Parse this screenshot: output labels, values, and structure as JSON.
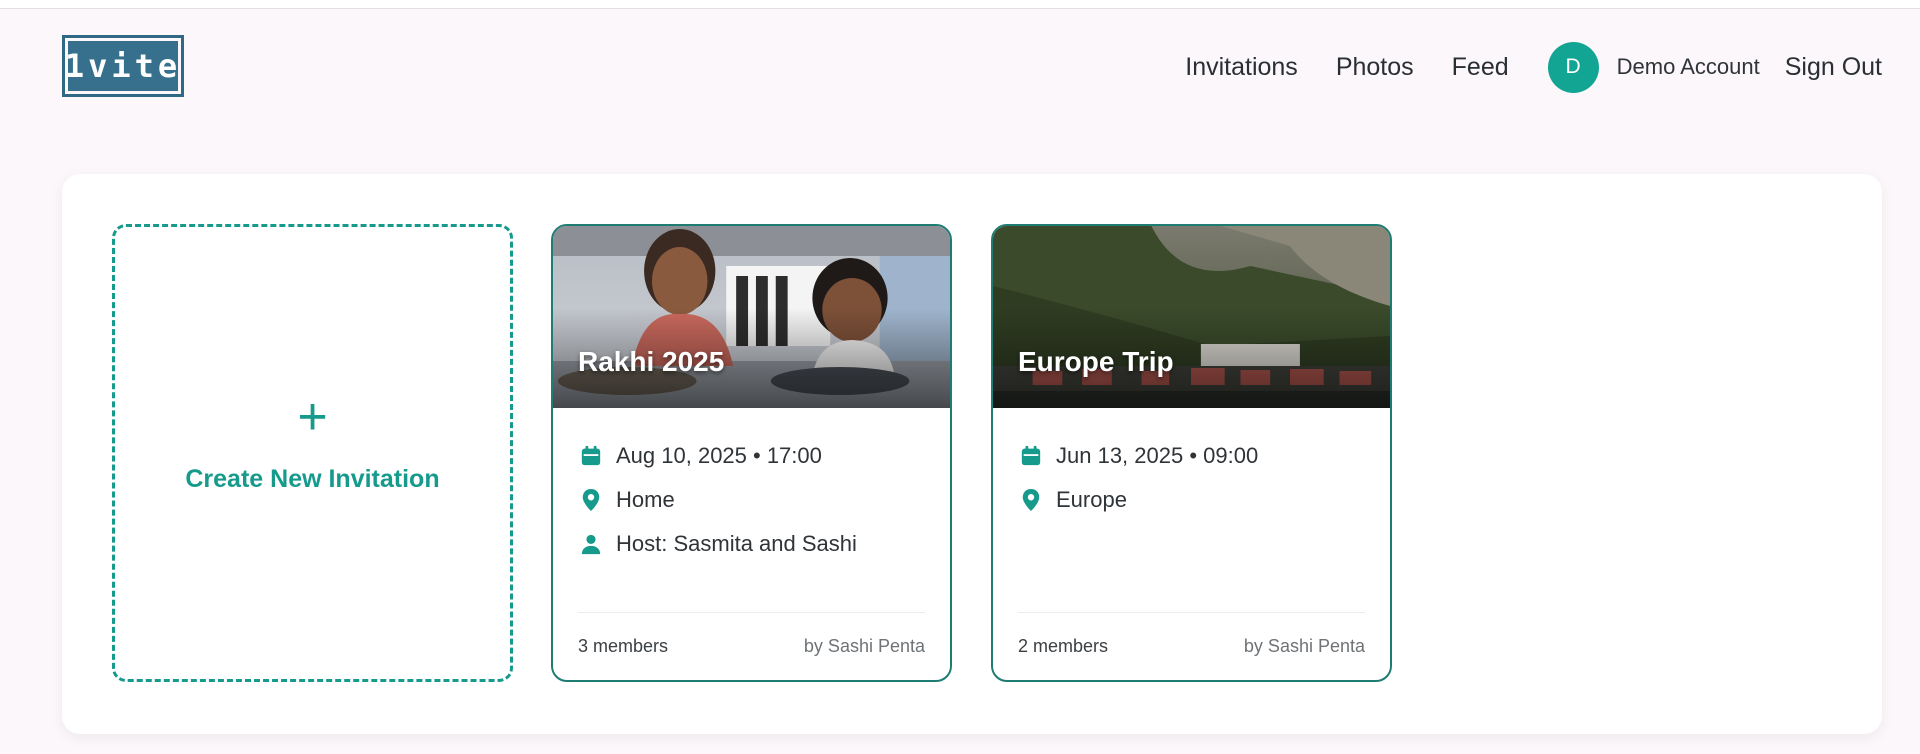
{
  "app": {
    "logo_text": "1vite"
  },
  "nav": {
    "items": [
      {
        "label": "Invitations"
      },
      {
        "label": "Photos"
      },
      {
        "label": "Feed"
      }
    ],
    "account": {
      "avatar_initial": "D",
      "name": "Demo Account"
    },
    "sign_out": "Sign Out"
  },
  "create_card": {
    "plus": "+",
    "label": "Create New Invitation"
  },
  "events": [
    {
      "title": "Rakhi 2025",
      "date": "Aug 10, 2025 • 17:00",
      "location": "Home",
      "host": "Host: Sasmita and Sashi",
      "members": "3 members",
      "by": "by Sashi Penta"
    },
    {
      "title": "Europe Trip",
      "date": "Jun 13, 2025 • 09:00",
      "location": "Europe",
      "members": "2 members",
      "by": "by Sashi Penta"
    }
  ],
  "colors": {
    "accent": "#169a8c",
    "avatar": "#12a593",
    "logo": "#36708c",
    "card_border": "#1f7c72"
  },
  "icons": {
    "date": "calendar-icon",
    "location": "location-pin-icon",
    "host": "person-icon"
  }
}
